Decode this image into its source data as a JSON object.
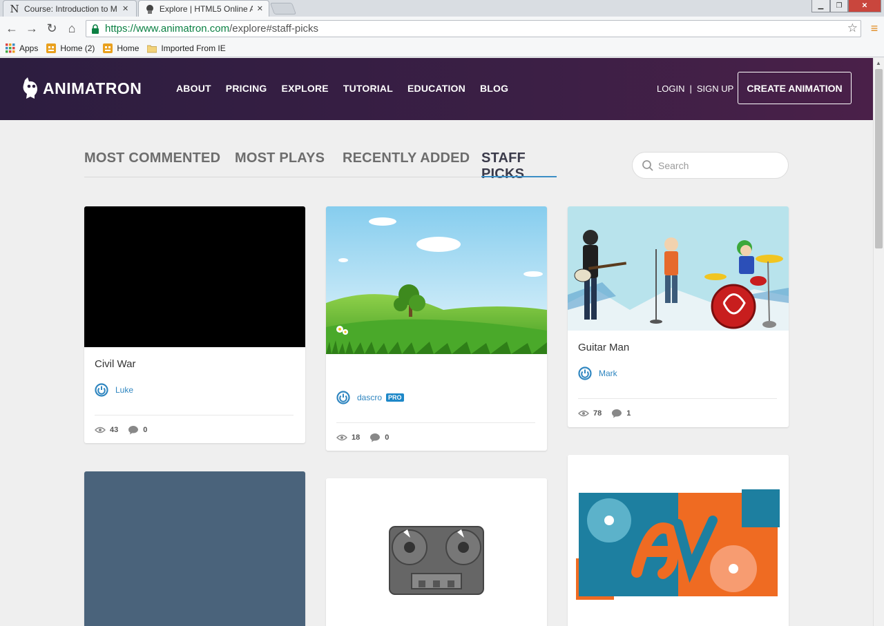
{
  "browser": {
    "tabs": [
      {
        "title": "Course: Introduction to M",
        "icon": "N"
      },
      {
        "title": "Explore | HTML5 Online A",
        "icon": "animatron-favicon"
      }
    ],
    "url": {
      "scheme_host": "https://www.animatron.com",
      "path": "/explore#staff-picks"
    },
    "bookmarks": [
      {
        "label": "Apps"
      },
      {
        "label": "Home (2)"
      },
      {
        "label": "Home"
      },
      {
        "label": "Imported From IE"
      }
    ]
  },
  "site": {
    "logo_text": "ANIMATRON",
    "nav": [
      "ABOUT",
      "PRICING",
      "EXPLORE",
      "TUTORIAL",
      "EDUCATION",
      "BLOG"
    ],
    "login": "LOGIN",
    "auth_sep": "|",
    "signup": "SIGN UP",
    "create_button": "CREATE ANIMATION"
  },
  "filters": {
    "items": [
      "MOST COMMENTED",
      "MOST PLAYS",
      "RECENTLY ADDED",
      "STAFF PICKS"
    ],
    "active": "STAFF PICKS"
  },
  "search": {
    "placeholder": "Search"
  },
  "cards": [
    {
      "title": "Civil War",
      "author": "Luke",
      "views": "43",
      "comments": "0"
    },
    {
      "title": "",
      "author": "dascro",
      "badge": "PRO",
      "views": "18",
      "comments": "0"
    },
    {
      "title": "Guitar Man",
      "author": "Mark",
      "views": "78",
      "comments": "1"
    }
  ],
  "colors": {
    "header_start": "#2c1d3f",
    "header_end": "#4a2049",
    "accent": "#3b8ec5",
    "link": "#2f86c0"
  }
}
